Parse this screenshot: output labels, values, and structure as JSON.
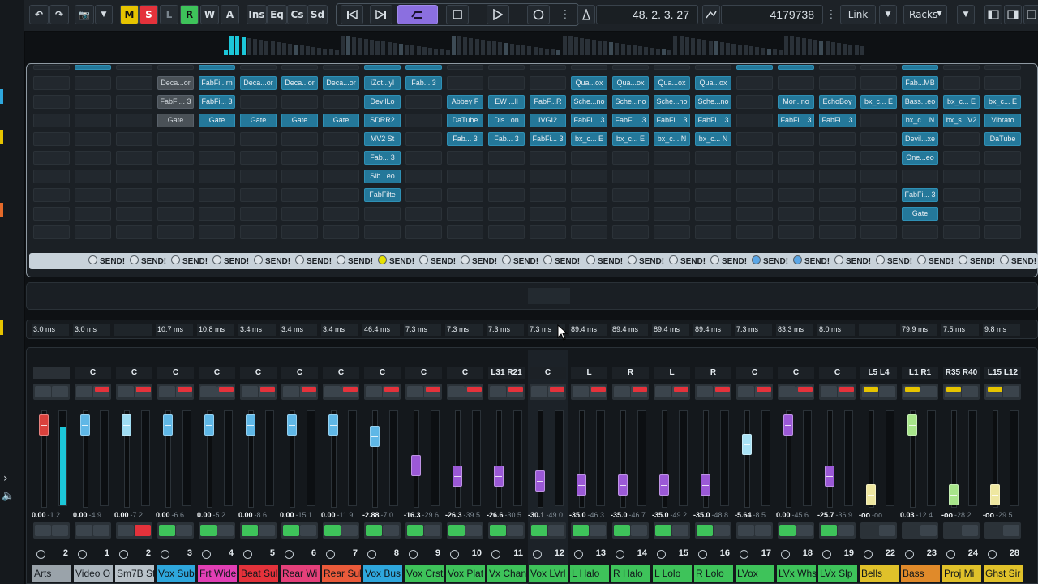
{
  "transport": {
    "undo_label": "↶",
    "redo_label": "↷",
    "snapshot_label": "📷",
    "dropdown_glyph": "▼",
    "modes": [
      "M",
      "S",
      "L",
      "R",
      "W",
      "A"
    ],
    "sections": [
      "Ins",
      "Eq",
      "Cs",
      "Sd"
    ],
    "position": "48. 2. 3. 27",
    "samples": "4179738",
    "link_label": "Link",
    "racks_label": "Racks",
    "menu_glyph": "⋮"
  },
  "inserts": {
    "rows": [
      [
        "",
        "",
        "",
        "Deca...or",
        "FabFi...rn",
        "Deca...or",
        "Deca...or",
        "Deca...or",
        "iZot...yl",
        "Fab... 3",
        "",
        "",
        "",
        "Qua...ox",
        "Qua...ox",
        "Qua...ox",
        "Qua...ox",
        "",
        "",
        "",
        "",
        "Fab...MB",
        "",
        ""
      ],
      [
        "",
        "",
        "",
        "FabFi... 3",
        "FabFi... 3",
        "",
        "",
        "",
        "DevilLo",
        "",
        "Abbey F",
        "EW ...ll",
        "FabF...R",
        "Sche...no",
        "Sche...no",
        "Sche...no",
        "Sche...no",
        "",
        "Mor...no",
        "EchoBoy",
        "bx_c... E",
        "Bass...eo",
        "bx_c... E",
        "bx_c... E"
      ],
      [
        "",
        "",
        "",
        "Gate",
        "Gate",
        "Gate",
        "Gate",
        "Gate",
        "SDRR2",
        "",
        "DaTube",
        "Dis...on",
        "IVGI2",
        "FabFi... 3",
        "FabFi... 3",
        "FabFi... 3",
        "FabFi... 3",
        "",
        "FabFi... 3",
        "FabFi... 3",
        "",
        "bx_c... N",
        "bx_s...V2",
        "Vibrato"
      ],
      [
        "",
        "",
        "",
        "",
        "",
        "",
        "",
        "",
        "MV2 St",
        "",
        "Fab... 3",
        "Fab... 3",
        "FabFi... 3",
        "bx_c... E",
        "bx_c... E",
        "bx_c... N",
        "bx_c... N",
        "",
        "",
        "",
        "",
        "Devil...xe",
        "",
        "DaTube"
      ],
      [
        "",
        "",
        "",
        "",
        "",
        "",
        "",
        "",
        "Fab... 3",
        "",
        "",
        "",
        "",
        "",
        "",
        "",
        "",
        "",
        "",
        "",
        "",
        "One...eo",
        "",
        ""
      ],
      [
        "",
        "",
        "",
        "",
        "",
        "",
        "",
        "",
        "Sib...eo",
        "",
        "",
        "",
        "",
        "",
        "",
        "",
        "",
        "",
        "",
        "",
        "",
        "",
        "",
        ""
      ],
      [
        "",
        "",
        "",
        "",
        "",
        "",
        "",
        "",
        "FabFilte",
        "",
        "",
        "",
        "",
        "",
        "",
        "",
        "",
        "",
        "",
        "",
        "",
        "FabFi... 3",
        "",
        ""
      ],
      [
        "",
        "",
        "",
        "",
        "",
        "",
        "",
        "",
        "",
        "",
        "",
        "",
        "",
        "",
        "",
        "",
        "",
        "",
        "",
        "",
        "",
        "Gate",
        "",
        ""
      ],
      [
        "",
        "",
        "",
        "",
        "",
        "",
        "",
        "",
        "",
        "",
        "",
        "",
        "",
        "",
        "",
        "",
        "",
        "",
        "",
        "",
        "",
        "",
        "",
        ""
      ]
    ],
    "send_label": "SEND!"
  },
  "latency": [
    "3.0 ms",
    "3.0 ms",
    "",
    "10.7 ms",
    "10.8 ms",
    "3.4 ms",
    "3.4 ms",
    "3.4 ms",
    "46.4 ms",
    "7.3 ms",
    "7.3 ms",
    "7.3 ms",
    "7.3 ms",
    "89.4 ms",
    "89.4 ms",
    "89.4 ms",
    "89.4 ms",
    "7.3 ms",
    "83.3 ms",
    "8.0 ms",
    "",
    "79.9 ms",
    "7.5 ms",
    "9.8 ms"
  ],
  "channels": [
    {
      "pan": "",
      "vol": "0.00",
      "peak": "-1.2",
      "num": "2",
      "name": "Arts",
      "color": "#9aa3aa",
      "fader": "#d9413c",
      "fy": 0.15,
      "meter": 0.82
    },
    {
      "pan": "C",
      "vol": "0.00",
      "peak": "-4.9",
      "num": "1",
      "name": "Video O",
      "color": "#aab4bc",
      "fader": "#5fb7e6",
      "fy": 0.15,
      "meter": 0
    },
    {
      "pan": "C",
      "vol": "0.00",
      "peak": "-7.2",
      "num": "2",
      "name": "Sm7B St",
      "color": "#b9c2c9",
      "fader": "#9fdcf2",
      "fy": 0.15,
      "meter": 0
    },
    {
      "pan": "C",
      "vol": "0.00",
      "peak": "-6.6",
      "num": "3",
      "name": "Vox Sub",
      "color": "#2ea7dd",
      "fader": "#5fb7e6",
      "fy": 0.15,
      "meter": 0
    },
    {
      "pan": "C",
      "vol": "0.00",
      "peak": "-5.2",
      "num": "4",
      "name": "Frt Wide",
      "color": "#e23fb5",
      "fader": "#5fb7e6",
      "fy": 0.15,
      "meter": 0
    },
    {
      "pan": "C",
      "vol": "0.00",
      "peak": "-8.6",
      "num": "5",
      "name": "Beat Sul",
      "color": "#e4323b",
      "fader": "#5fb7e6",
      "fy": 0.15,
      "meter": 0
    },
    {
      "pan": "C",
      "vol": "0.00",
      "peak": "-15.1",
      "num": "6",
      "name": "Rear Wi",
      "color": "#e5407a",
      "fader": "#5fb7e6",
      "fy": 0.15,
      "meter": 0
    },
    {
      "pan": "C",
      "vol": "0.00",
      "peak": "-11.9",
      "num": "7",
      "name": "Rear Sul",
      "color": "#ea5a3a",
      "fader": "#5fb7e6",
      "fy": 0.15,
      "meter": 0
    },
    {
      "pan": "C",
      "vol": "-2.88",
      "peak": "-7.0",
      "num": "8",
      "name": "Vox Bus",
      "color": "#2ea7dd",
      "fader": "#5fb7e6",
      "fy": 0.27,
      "meter": 0
    },
    {
      "pan": "C",
      "vol": "-16.3",
      "peak": "-29.6",
      "num": "9",
      "name": "Vox Crst",
      "color": "#3ec35a",
      "fader": "#9b59d6",
      "fy": 0.58,
      "meter": 0
    },
    {
      "pan": "C",
      "vol": "-26.3",
      "peak": "-39.5",
      "num": "10",
      "name": "Vox Plat",
      "color": "#3ec35a",
      "fader": "#9b59d6",
      "fy": 0.69,
      "meter": 0
    },
    {
      "pan": "L31 R21",
      "vol": "-26.6",
      "peak": "-30.5",
      "num": "11",
      "name": "Vx Chan",
      "color": "#3ec35a",
      "fader": "#9b59d6",
      "fy": 0.69,
      "meter": 0
    },
    {
      "pan": "C",
      "vol": "-30.1",
      "peak": "-49.0",
      "num": "12",
      "name": "Vox LVrl",
      "color": "#3ec35a",
      "fader": "#9b59d6",
      "fy": 0.74,
      "meter": 0
    },
    {
      "pan": "L",
      "vol": "-35.0",
      "peak": "-46.3",
      "num": "13",
      "name": "L Halo",
      "color": "#3ec35a",
      "fader": "#9b59d6",
      "fy": 0.78,
      "meter": 0
    },
    {
      "pan": "R",
      "vol": "-35.0",
      "peak": "-46.7",
      "num": "14",
      "name": "R Halo",
      "color": "#3ec35a",
      "fader": "#9b59d6",
      "fy": 0.78,
      "meter": 0
    },
    {
      "pan": "L",
      "vol": "-35.0",
      "peak": "-49.2",
      "num": "15",
      "name": "L Lolo",
      "color": "#3ec35a",
      "fader": "#9b59d6",
      "fy": 0.78,
      "meter": 0
    },
    {
      "pan": "R",
      "vol": "-35.0",
      "peak": "-48.8",
      "num": "16",
      "name": "R Lolo",
      "color": "#3ec35a",
      "fader": "#9b59d6",
      "fy": 0.78,
      "meter": 0
    },
    {
      "pan": "C",
      "vol": "-5.64",
      "peak": "-8.5",
      "num": "17",
      "name": "LVox",
      "color": "#3ec35a",
      "fader": "#a9e2f5",
      "fy": 0.36,
      "meter": 0
    },
    {
      "pan": "C",
      "vol": "0.00",
      "peak": "-45.6",
      "num": "18",
      "name": "LVx Whs",
      "color": "#3ec35a",
      "fader": "#9b59d6",
      "fy": 0.15,
      "meter": 0
    },
    {
      "pan": "C",
      "vol": "-25.7",
      "peak": "-36.9",
      "num": "19",
      "name": "LVx Slp",
      "color": "#3ec35a",
      "fader": "#9b59d6",
      "fy": 0.69,
      "meter": 0
    },
    {
      "pan": "L5 L4",
      "vol": "-oo",
      "peak": "-oo",
      "num": "22",
      "name": "Bells",
      "color": "#e0c12a",
      "fader": "#eee7a0",
      "fy": 0.88,
      "meter": 0
    },
    {
      "pan": "L1 R1",
      "vol": "0.03",
      "peak": "-12.4",
      "num": "23",
      "name": "Bass",
      "color": "#e08a2a",
      "fader": "#a7e58a",
      "fy": 0.15,
      "meter": 0
    },
    {
      "pan": "R35 R40",
      "vol": "-oo",
      "peak": "-28.2",
      "num": "24",
      "name": "Proj Mi",
      "color": "#e0c12a",
      "fader": "#a7e58a",
      "fy": 0.88,
      "meter": 0
    },
    {
      "pan": "L15 L12",
      "vol": "-oo",
      "peak": "-29.5",
      "num": "28",
      "name": "Ghst Sir",
      "color": "#e0c12a",
      "fader": "#eee7a0",
      "fy": 0.88,
      "meter": 0
    }
  ]
}
